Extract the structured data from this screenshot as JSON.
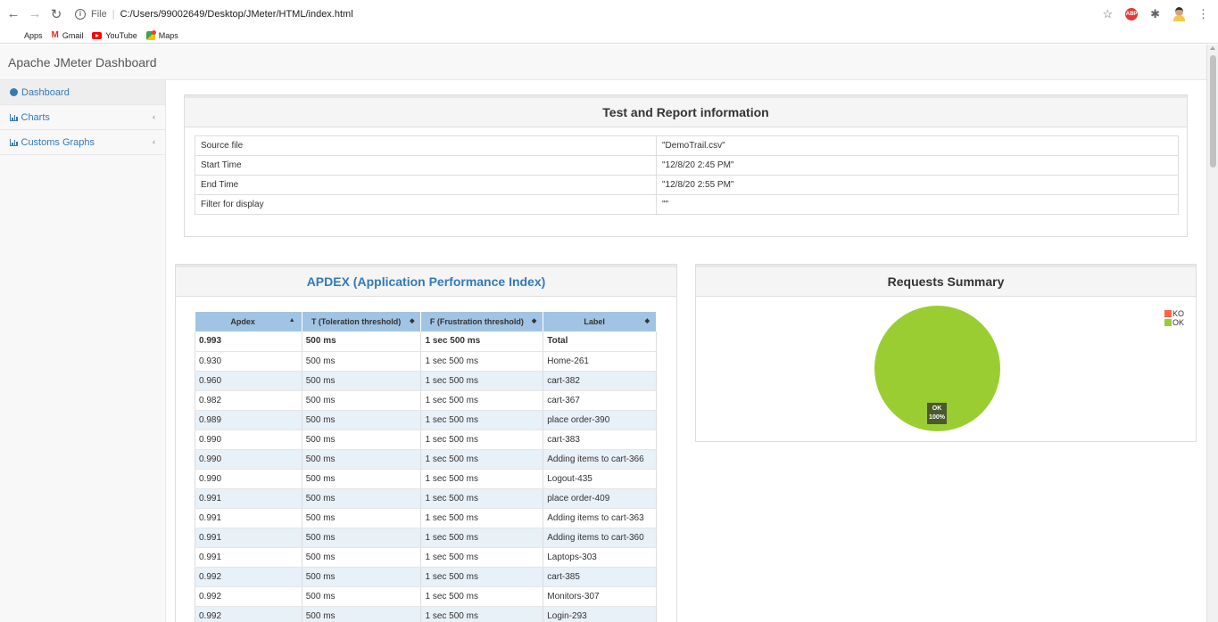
{
  "browser": {
    "address_scheme": "File",
    "address_url": "C:/Users/99002649/Desktop/JMeter/HTML/index.html",
    "bookmarks": [
      {
        "label": "Apps",
        "icon": "apps-grid-icon"
      },
      {
        "label": "Gmail",
        "icon": "gmail-icon"
      },
      {
        "label": "YouTube",
        "icon": "youtube-icon"
      },
      {
        "label": "Maps",
        "icon": "maps-icon"
      }
    ],
    "extension_badge": "ABP"
  },
  "app": {
    "brand": "Apache JMeter Dashboard"
  },
  "sidebar": {
    "items": [
      {
        "label": "Dashboard",
        "icon": "dashboard-icon"
      },
      {
        "label": "Charts",
        "icon": "bar-chart-icon"
      },
      {
        "label": "Customs Graphs",
        "icon": "bar-chart-icon"
      }
    ]
  },
  "info_panel": {
    "title": "Test and Report information",
    "rows": [
      {
        "key": "Source file",
        "value": "\"DemoTrail.csv\""
      },
      {
        "key": "Start Time",
        "value": "\"12/8/20 2:45 PM\""
      },
      {
        "key": "End Time",
        "value": "\"12/8/20 2:55 PM\""
      },
      {
        "key": "Filter for display",
        "value": "\"\""
      }
    ]
  },
  "apdex_panel": {
    "title": "APDEX (Application Performance Index)",
    "columns": [
      "Apdex",
      "T (Toleration threshold)",
      "F (Frustration threshold)",
      "Label"
    ],
    "rows": [
      [
        "0.993",
        "500 ms",
        "1 sec 500 ms",
        "Total"
      ],
      [
        "0.930",
        "500 ms",
        "1 sec 500 ms",
        "Home-261"
      ],
      [
        "0.960",
        "500 ms",
        "1 sec 500 ms",
        "cart-382"
      ],
      [
        "0.982",
        "500 ms",
        "1 sec 500 ms",
        "cart-367"
      ],
      [
        "0.989",
        "500 ms",
        "1 sec 500 ms",
        "place order-390"
      ],
      [
        "0.990",
        "500 ms",
        "1 sec 500 ms",
        "cart-383"
      ],
      [
        "0.990",
        "500 ms",
        "1 sec 500 ms",
        "Adding items to cart-366"
      ],
      [
        "0.990",
        "500 ms",
        "1 sec 500 ms",
        "Logout-435"
      ],
      [
        "0.991",
        "500 ms",
        "1 sec 500 ms",
        "place order-409"
      ],
      [
        "0.991",
        "500 ms",
        "1 sec 500 ms",
        "Adding items to cart-363"
      ],
      [
        "0.991",
        "500 ms",
        "1 sec 500 ms",
        "Adding items to cart-360"
      ],
      [
        "0.991",
        "500 ms",
        "1 sec 500 ms",
        "Laptops-303"
      ],
      [
        "0.992",
        "500 ms",
        "1 sec 500 ms",
        "cart-385"
      ],
      [
        "0.992",
        "500 ms",
        "1 sec 500 ms",
        "Monitors-307"
      ],
      [
        "0.992",
        "500 ms",
        "1 sec 500 ms",
        "Login-293"
      ]
    ]
  },
  "requests_panel": {
    "title": "Requests Summary",
    "pie_label": "OK",
    "pie_percent": "100%",
    "legend": [
      {
        "label": "KO",
        "color": "#ff6347"
      },
      {
        "label": "OK",
        "color": "#9acd32"
      }
    ],
    "slices": [
      {
        "label": "OK",
        "fraction": 1.0,
        "color": "#9acd32"
      },
      {
        "label": "KO",
        "fraction": 0.0,
        "color": "#ff6347"
      }
    ]
  }
}
